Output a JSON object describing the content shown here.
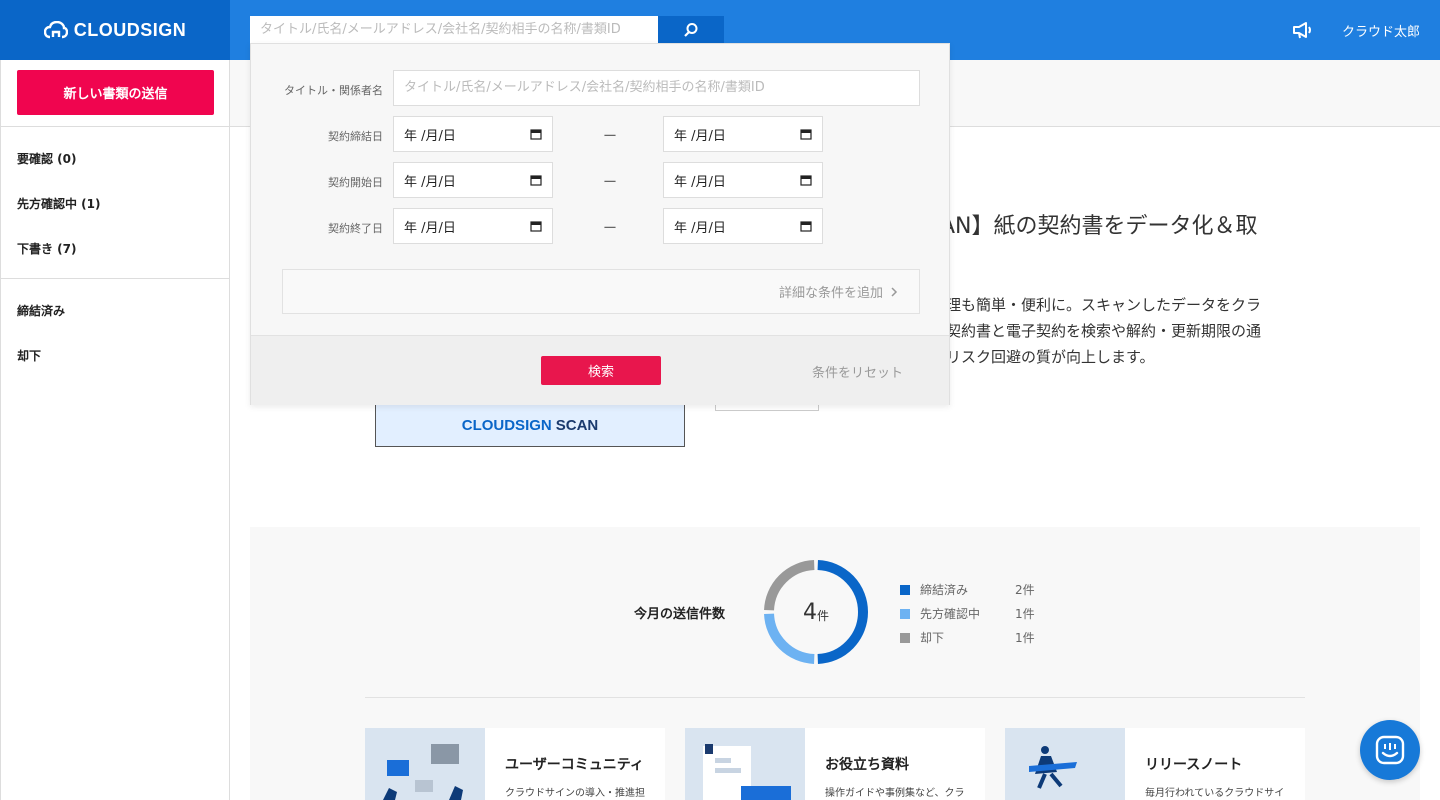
{
  "header": {
    "logo_text": "CLOUDSIGN",
    "search_placeholder": "タイトル/氏名/メールアドレス/会社名/契約相手の名称/書類ID",
    "user_name": "クラウド太郎",
    "brand_color": "#1f7fe0"
  },
  "sidebar": {
    "new_doc_button": "新しい書類の送信",
    "items": [
      {
        "label": "要確認 (0)"
      },
      {
        "label": "先方確認中 (1)"
      },
      {
        "label": "下書き (7)"
      },
      {
        "label": "締結済み"
      },
      {
        "label": "却下"
      }
    ]
  },
  "banner": {
    "title": "AN】紙の契約書をデータ化＆取",
    "desc_lines": [
      "理も簡単・便利に。スキャンしたデータをクラ",
      "契約書と電子契約を検索や解約・更新期限の通",
      "リスク回避の質が向上します。"
    ],
    "image_text_main": "CLOUDSIGN",
    "image_text_scan": "SCAN"
  },
  "search_panel": {
    "title_label": "タイトル・関係者名",
    "title_placeholder": "タイトル/氏名/メールアドレス/会社名/契約相手の名称/書類ID",
    "date_rows": [
      {
        "label": "契約締結日",
        "from": "年 /月/日",
        "to": "年 /月/日"
      },
      {
        "label": "契約開始日",
        "from": "年 /月/日",
        "to": "年 /月/日"
      },
      {
        "label": "契約終了日",
        "from": "年 /月/日",
        "to": "年 /月/日"
      }
    ],
    "range_separator": "ー",
    "add_conditions": "詳細な条件を追加",
    "search_button": "検索",
    "reset_link": "条件をリセット"
  },
  "stats": {
    "label": "今月の送信件数",
    "total": "4",
    "unit": "件",
    "legend": [
      {
        "name": "締結済み",
        "count": "2件",
        "value": 2,
        "color": "#0a66c8"
      },
      {
        "name": "先方確認中",
        "count": "1件",
        "value": 1,
        "color": "#6db2f2"
      },
      {
        "name": "却下",
        "count": "1件",
        "value": 1,
        "color": "#999999"
      }
    ]
  },
  "cards": [
    {
      "title": "ユーザーコミュニティ",
      "text": "クラウドサインの導入・推進担"
    },
    {
      "title": "お役立ち資料",
      "text": "操作ガイドや事例集など、クラ"
    },
    {
      "title": "リリースノート",
      "text": "毎月行われているクラウドサイ"
    }
  ]
}
